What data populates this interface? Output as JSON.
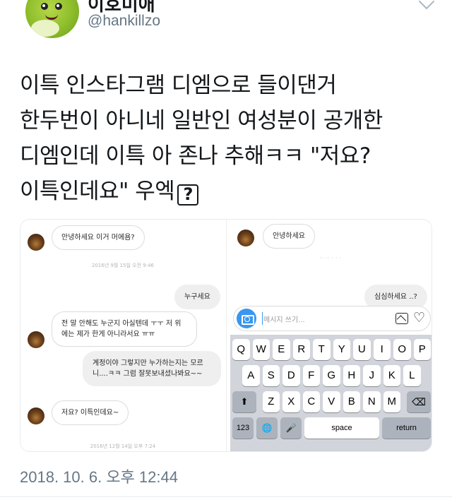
{
  "author": {
    "display_name": "이호미애",
    "handle": "@hankillzo"
  },
  "tweet": {
    "lines": [
      "이특 인스타그램 디엠으로 들이댄거",
      "한두번이 아니네 일반인 여성분이 공개한",
      "디엠인데 이특 아 존나 추해ㅋㅋ \"저요?",
      "이특인데요\" 우엑"
    ],
    "emoji": "?",
    "timestamp": "2018. 10. 6. 오후 12:44"
  },
  "left_chat": {
    "msg1": "안녕하세요 이거 머에욤?",
    "ts1": "2016년 9월 15일 오전 9:46",
    "msg2": "누구세요",
    "msg3": "전 말 안해도 누군지 아실텐데 ㅜㅜ 저 위에는 제가 한게 아니라서요 ㅠㅠ",
    "msg4": "계정이야 그렇지만 누가하는지는 모르니....ㅋㅋ 그럼 잘못보내셨나봐요~~",
    "msg5": "저요? 이특인데요~",
    "ts2": "2016년 12월 14일 오후 7:24"
  },
  "right_chat": {
    "msg1": "안녕하세요",
    "typing": "·· ·· · · ·",
    "msg2": "심심하세요 ..?",
    "input_placeholder": "메시지 쓰기..."
  },
  "keyboard": {
    "row1": [
      "Q",
      "W",
      "E",
      "R",
      "T",
      "Y",
      "U",
      "I",
      "O",
      "P"
    ],
    "row2": [
      "A",
      "S",
      "D",
      "F",
      "G",
      "H",
      "J",
      "K",
      "L"
    ],
    "row3": [
      "Z",
      "X",
      "C",
      "V",
      "B",
      "N",
      "M"
    ],
    "numbers": "123",
    "space": "space",
    "return": "return",
    "shift": "⬆",
    "backspace": "⌫",
    "globe": "🌐",
    "mic": "🎤"
  }
}
